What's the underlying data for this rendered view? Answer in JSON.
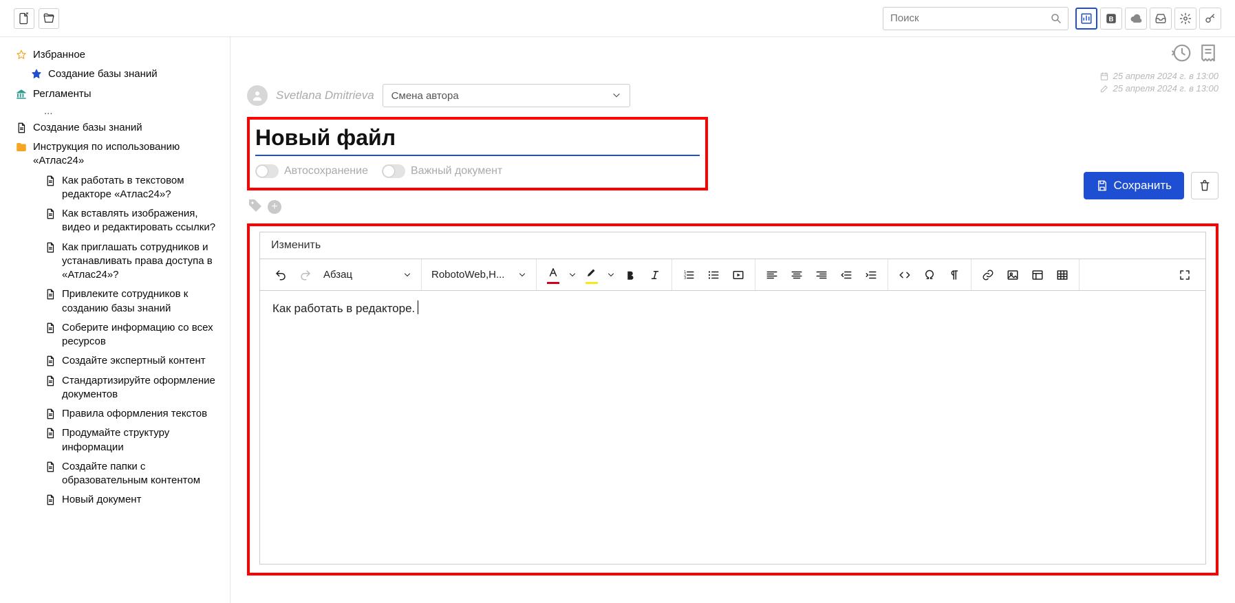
{
  "search": {
    "placeholder": "Поиск"
  },
  "sidebar": {
    "favorites": "Избранное",
    "fav_child": "Создание базы знаний",
    "reglaments": "Регламенты",
    "ellipsis": "...",
    "create_kb": "Создание базы знаний",
    "instructions": "Инструкция по использованию «Атлас24»",
    "docs": [
      "Как работать в текстовом редакторе «Атлас24»?",
      "Как вставлять изображения, видео и редактировать ссылки?",
      "Как приглашать сотрудников и устанавливать права доступа в «Атлас24»?",
      "Привлеките сотрудников к созданию базы знаний",
      "Соберите информацию со всех ресурсов",
      "Создайте экспертный контент",
      "Стандартизируйте оформление документов",
      "Правила оформления текстов",
      "Продумайте структуру информации",
      "Создайте папки с образовательным контентом",
      "Новый документ"
    ]
  },
  "dates": {
    "created": "25 апреля 2024 г. в 13:00",
    "modified": "25 апреля 2024 г. в 13:00"
  },
  "author": {
    "name": "Svetlana Dmitrieva",
    "select_label": "Смена автора"
  },
  "title": "Новый файл",
  "save_label": "Сохранить",
  "toggles": {
    "autosave": "Автосохранение",
    "important": "Важный документ"
  },
  "editor": {
    "tab_label": "Изменить",
    "paragraph_label": "Абзац",
    "font_label": "RobotoWeb,H...",
    "content": "Как работать в редакторе."
  }
}
